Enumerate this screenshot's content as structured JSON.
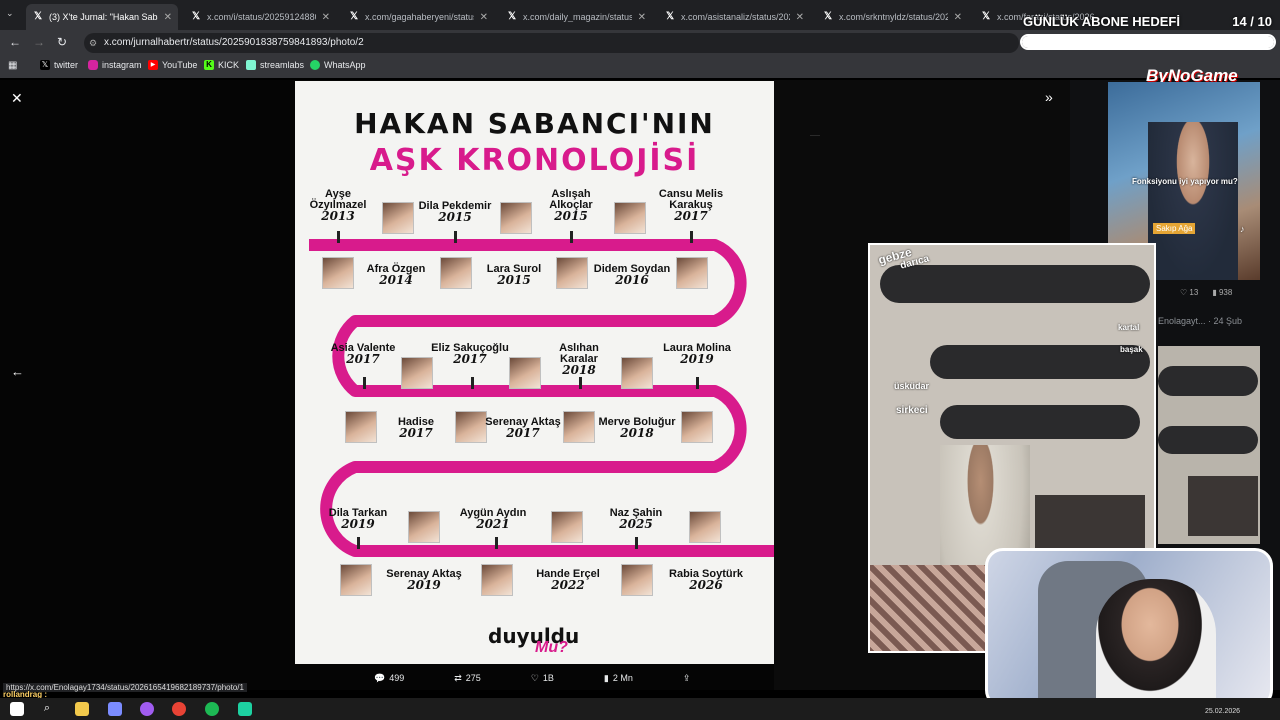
{
  "tabs": [
    {
      "label": "(3) X'te Jurnal: \"Hakan Sabancı'n",
      "active": true
    },
    {
      "label": "x.com/i/status/2025912488034"
    },
    {
      "label": "x.com/gagahaberyeni/status/2("
    },
    {
      "label": "x.com/daily_magazin/status/2("
    },
    {
      "label": "x.com/asistanaliz/status/20262"
    },
    {
      "label": "x.com/srkntnyldz/status/20262"
    },
    {
      "label": "x.com/farazi/status/2026"
    }
  ],
  "address": {
    "url": "x.com/jurnalhabertr/status/2025901838759841893/photo/2"
  },
  "bookmarks": [
    {
      "label": "twitter",
      "color": "#000000"
    },
    {
      "label": "instagram",
      "color": "#d6249f"
    },
    {
      "label": "YouTube",
      "color": "#ff0000"
    },
    {
      "label": "KICK",
      "color": "#53fc18"
    },
    {
      "label": "streamlabs",
      "color": "#80f5d2"
    },
    {
      "label": "WhatsApp",
      "color": "#25d366"
    }
  ],
  "stream_overlay": {
    "goal_title": "GÜNLÜK ABONE HEDEFİ",
    "goal_count": "14 / 10",
    "brand": "ByNoGame"
  },
  "poster": {
    "title_line1": "HAKAN SABANCI'NIN",
    "title_line2": "AŞK KRONOLOJİSİ",
    "accent": "#d81b8c",
    "people": [
      {
        "name": "Ayşe Özyılmazel",
        "year": "2013"
      },
      {
        "name": "Afra Özgen",
        "year": "2014"
      },
      {
        "name": "Dila Pekdemir",
        "year": "2015"
      },
      {
        "name": "Lara Surol",
        "year": "2015"
      },
      {
        "name": "Aslışah Alkoçlar",
        "year": "2015"
      },
      {
        "name": "Didem Soydan",
        "year": "2016"
      },
      {
        "name": "Cansu Melis Karakuş",
        "year": "2017"
      },
      {
        "name": "Asia Valente",
        "year": "2017"
      },
      {
        "name": "Hadise",
        "year": "2017"
      },
      {
        "name": "Eliz Sakuçoğlu",
        "year": "2017"
      },
      {
        "name": "Serenay Aktaş",
        "year": "2017"
      },
      {
        "name": "Aslıhan Karalar",
        "year": "2018"
      },
      {
        "name": "Merve Boluğur",
        "year": "2018"
      },
      {
        "name": "Laura Molina",
        "year": "2019"
      },
      {
        "name": "Dila Tarkan",
        "year": "2019"
      },
      {
        "name": "Serenay Aktaş",
        "year": "2019"
      },
      {
        "name": "Aygün Aydın",
        "year": "2021"
      },
      {
        "name": "Hande Erçel",
        "year": "2022"
      },
      {
        "name": "Naz Şahin",
        "year": "2025"
      },
      {
        "name": "Rabia Soytürk",
        "year": "2026"
      }
    ],
    "footer_logo": "duyuldu",
    "footer_q": "Mu?"
  },
  "actions": {
    "replies": "499",
    "reposts": "275",
    "likes": "1B",
    "views": "2 Mn"
  },
  "tiktok": {
    "caption": "Fonksiyonu iyi yapıyor mu?",
    "tag": "Sakıp Ağa",
    "likes": "13",
    "views": "938"
  },
  "right_meta": "Enolagayt... · 24 Şub",
  "video_words": [
    "gebze",
    "darıca",
    "kartal",
    "başak",
    "üsküdar",
    "sirkeci"
  ],
  "status_link": "https://x.com/Enolagay1734/status/2026165419682189737/photo/1",
  "chat_user": "rollandrag :",
  "clock_date": "25.02.2026"
}
